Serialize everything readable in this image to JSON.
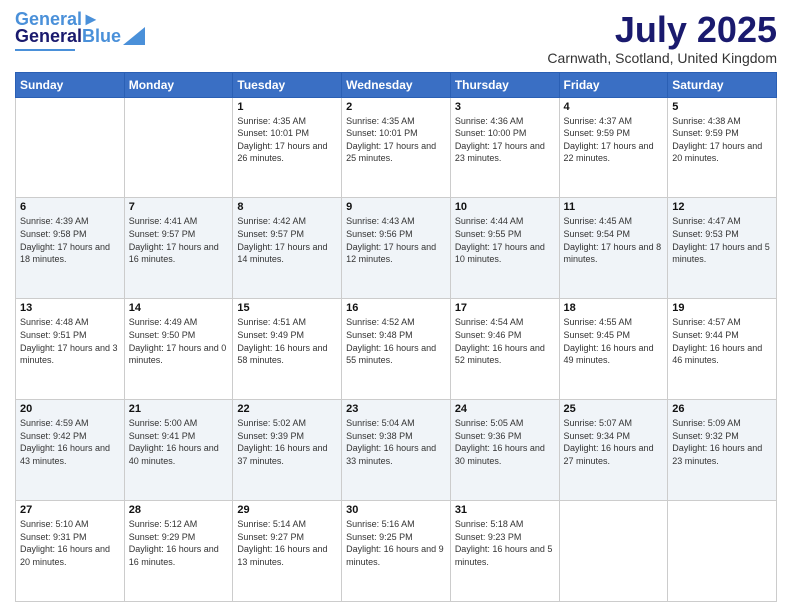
{
  "logo": {
    "text_general": "General",
    "text_blue": "Blue"
  },
  "title": "July 2025",
  "subtitle": "Carnwath, Scotland, United Kingdom",
  "days_of_week": [
    "Sunday",
    "Monday",
    "Tuesday",
    "Wednesday",
    "Thursday",
    "Friday",
    "Saturday"
  ],
  "weeks": [
    [
      {
        "day": "",
        "sunrise": "",
        "sunset": "",
        "daylight": ""
      },
      {
        "day": "",
        "sunrise": "",
        "sunset": "",
        "daylight": ""
      },
      {
        "day": "1",
        "sunrise": "Sunrise: 4:35 AM",
        "sunset": "Sunset: 10:01 PM",
        "daylight": "Daylight: 17 hours and 26 minutes."
      },
      {
        "day": "2",
        "sunrise": "Sunrise: 4:35 AM",
        "sunset": "Sunset: 10:01 PM",
        "daylight": "Daylight: 17 hours and 25 minutes."
      },
      {
        "day": "3",
        "sunrise": "Sunrise: 4:36 AM",
        "sunset": "Sunset: 10:00 PM",
        "daylight": "Daylight: 17 hours and 23 minutes."
      },
      {
        "day": "4",
        "sunrise": "Sunrise: 4:37 AM",
        "sunset": "Sunset: 9:59 PM",
        "daylight": "Daylight: 17 hours and 22 minutes."
      },
      {
        "day": "5",
        "sunrise": "Sunrise: 4:38 AM",
        "sunset": "Sunset: 9:59 PM",
        "daylight": "Daylight: 17 hours and 20 minutes."
      }
    ],
    [
      {
        "day": "6",
        "sunrise": "Sunrise: 4:39 AM",
        "sunset": "Sunset: 9:58 PM",
        "daylight": "Daylight: 17 hours and 18 minutes."
      },
      {
        "day": "7",
        "sunrise": "Sunrise: 4:41 AM",
        "sunset": "Sunset: 9:57 PM",
        "daylight": "Daylight: 17 hours and 16 minutes."
      },
      {
        "day": "8",
        "sunrise": "Sunrise: 4:42 AM",
        "sunset": "Sunset: 9:57 PM",
        "daylight": "Daylight: 17 hours and 14 minutes."
      },
      {
        "day": "9",
        "sunrise": "Sunrise: 4:43 AM",
        "sunset": "Sunset: 9:56 PM",
        "daylight": "Daylight: 17 hours and 12 minutes."
      },
      {
        "day": "10",
        "sunrise": "Sunrise: 4:44 AM",
        "sunset": "Sunset: 9:55 PM",
        "daylight": "Daylight: 17 hours and 10 minutes."
      },
      {
        "day": "11",
        "sunrise": "Sunrise: 4:45 AM",
        "sunset": "Sunset: 9:54 PM",
        "daylight": "Daylight: 17 hours and 8 minutes."
      },
      {
        "day": "12",
        "sunrise": "Sunrise: 4:47 AM",
        "sunset": "Sunset: 9:53 PM",
        "daylight": "Daylight: 17 hours and 5 minutes."
      }
    ],
    [
      {
        "day": "13",
        "sunrise": "Sunrise: 4:48 AM",
        "sunset": "Sunset: 9:51 PM",
        "daylight": "Daylight: 17 hours and 3 minutes."
      },
      {
        "day": "14",
        "sunrise": "Sunrise: 4:49 AM",
        "sunset": "Sunset: 9:50 PM",
        "daylight": "Daylight: 17 hours and 0 minutes."
      },
      {
        "day": "15",
        "sunrise": "Sunrise: 4:51 AM",
        "sunset": "Sunset: 9:49 PM",
        "daylight": "Daylight: 16 hours and 58 minutes."
      },
      {
        "day": "16",
        "sunrise": "Sunrise: 4:52 AM",
        "sunset": "Sunset: 9:48 PM",
        "daylight": "Daylight: 16 hours and 55 minutes."
      },
      {
        "day": "17",
        "sunrise": "Sunrise: 4:54 AM",
        "sunset": "Sunset: 9:46 PM",
        "daylight": "Daylight: 16 hours and 52 minutes."
      },
      {
        "day": "18",
        "sunrise": "Sunrise: 4:55 AM",
        "sunset": "Sunset: 9:45 PM",
        "daylight": "Daylight: 16 hours and 49 minutes."
      },
      {
        "day": "19",
        "sunrise": "Sunrise: 4:57 AM",
        "sunset": "Sunset: 9:44 PM",
        "daylight": "Daylight: 16 hours and 46 minutes."
      }
    ],
    [
      {
        "day": "20",
        "sunrise": "Sunrise: 4:59 AM",
        "sunset": "Sunset: 9:42 PM",
        "daylight": "Daylight: 16 hours and 43 minutes."
      },
      {
        "day": "21",
        "sunrise": "Sunrise: 5:00 AM",
        "sunset": "Sunset: 9:41 PM",
        "daylight": "Daylight: 16 hours and 40 minutes."
      },
      {
        "day": "22",
        "sunrise": "Sunrise: 5:02 AM",
        "sunset": "Sunset: 9:39 PM",
        "daylight": "Daylight: 16 hours and 37 minutes."
      },
      {
        "day": "23",
        "sunrise": "Sunrise: 5:04 AM",
        "sunset": "Sunset: 9:38 PM",
        "daylight": "Daylight: 16 hours and 33 minutes."
      },
      {
        "day": "24",
        "sunrise": "Sunrise: 5:05 AM",
        "sunset": "Sunset: 9:36 PM",
        "daylight": "Daylight: 16 hours and 30 minutes."
      },
      {
        "day": "25",
        "sunrise": "Sunrise: 5:07 AM",
        "sunset": "Sunset: 9:34 PM",
        "daylight": "Daylight: 16 hours and 27 minutes."
      },
      {
        "day": "26",
        "sunrise": "Sunrise: 5:09 AM",
        "sunset": "Sunset: 9:32 PM",
        "daylight": "Daylight: 16 hours and 23 minutes."
      }
    ],
    [
      {
        "day": "27",
        "sunrise": "Sunrise: 5:10 AM",
        "sunset": "Sunset: 9:31 PM",
        "daylight": "Daylight: 16 hours and 20 minutes."
      },
      {
        "day": "28",
        "sunrise": "Sunrise: 5:12 AM",
        "sunset": "Sunset: 9:29 PM",
        "daylight": "Daylight: 16 hours and 16 minutes."
      },
      {
        "day": "29",
        "sunrise": "Sunrise: 5:14 AM",
        "sunset": "Sunset: 9:27 PM",
        "daylight": "Daylight: 16 hours and 13 minutes."
      },
      {
        "day": "30",
        "sunrise": "Sunrise: 5:16 AM",
        "sunset": "Sunset: 9:25 PM",
        "daylight": "Daylight: 16 hours and 9 minutes."
      },
      {
        "day": "31",
        "sunrise": "Sunrise: 5:18 AM",
        "sunset": "Sunset: 9:23 PM",
        "daylight": "Daylight: 16 hours and 5 minutes."
      },
      {
        "day": "",
        "sunrise": "",
        "sunset": "",
        "daylight": ""
      },
      {
        "day": "",
        "sunrise": "",
        "sunset": "",
        "daylight": ""
      }
    ]
  ]
}
